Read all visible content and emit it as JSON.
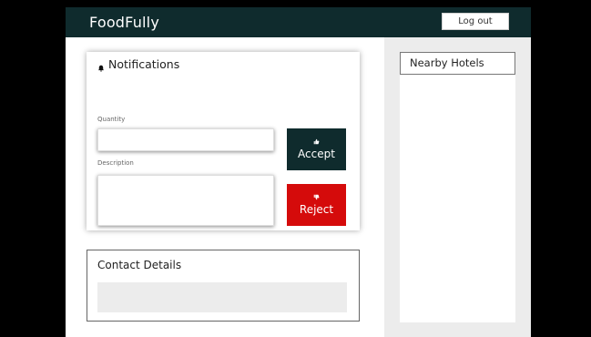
{
  "header": {
    "brand": "FoodFully",
    "logout_label": "Log out"
  },
  "notifications": {
    "title": "Notifications",
    "quantity_label": "Quantity",
    "quantity_value": "",
    "description_label": "Description",
    "description_value": "",
    "accept_label": "Accept",
    "reject_label": "Reject"
  },
  "contact": {
    "title": "Contact Details"
  },
  "hotels": {
    "title": "Nearby Hotels"
  },
  "colors": {
    "brand_dark": "#0f2b2d",
    "reject_red": "#d50b0b",
    "panel_gray": "#ececec"
  },
  "icons": {
    "notifications": "bell-icon",
    "accept": "thumbs-up-icon",
    "reject": "thumbs-down-icon"
  }
}
